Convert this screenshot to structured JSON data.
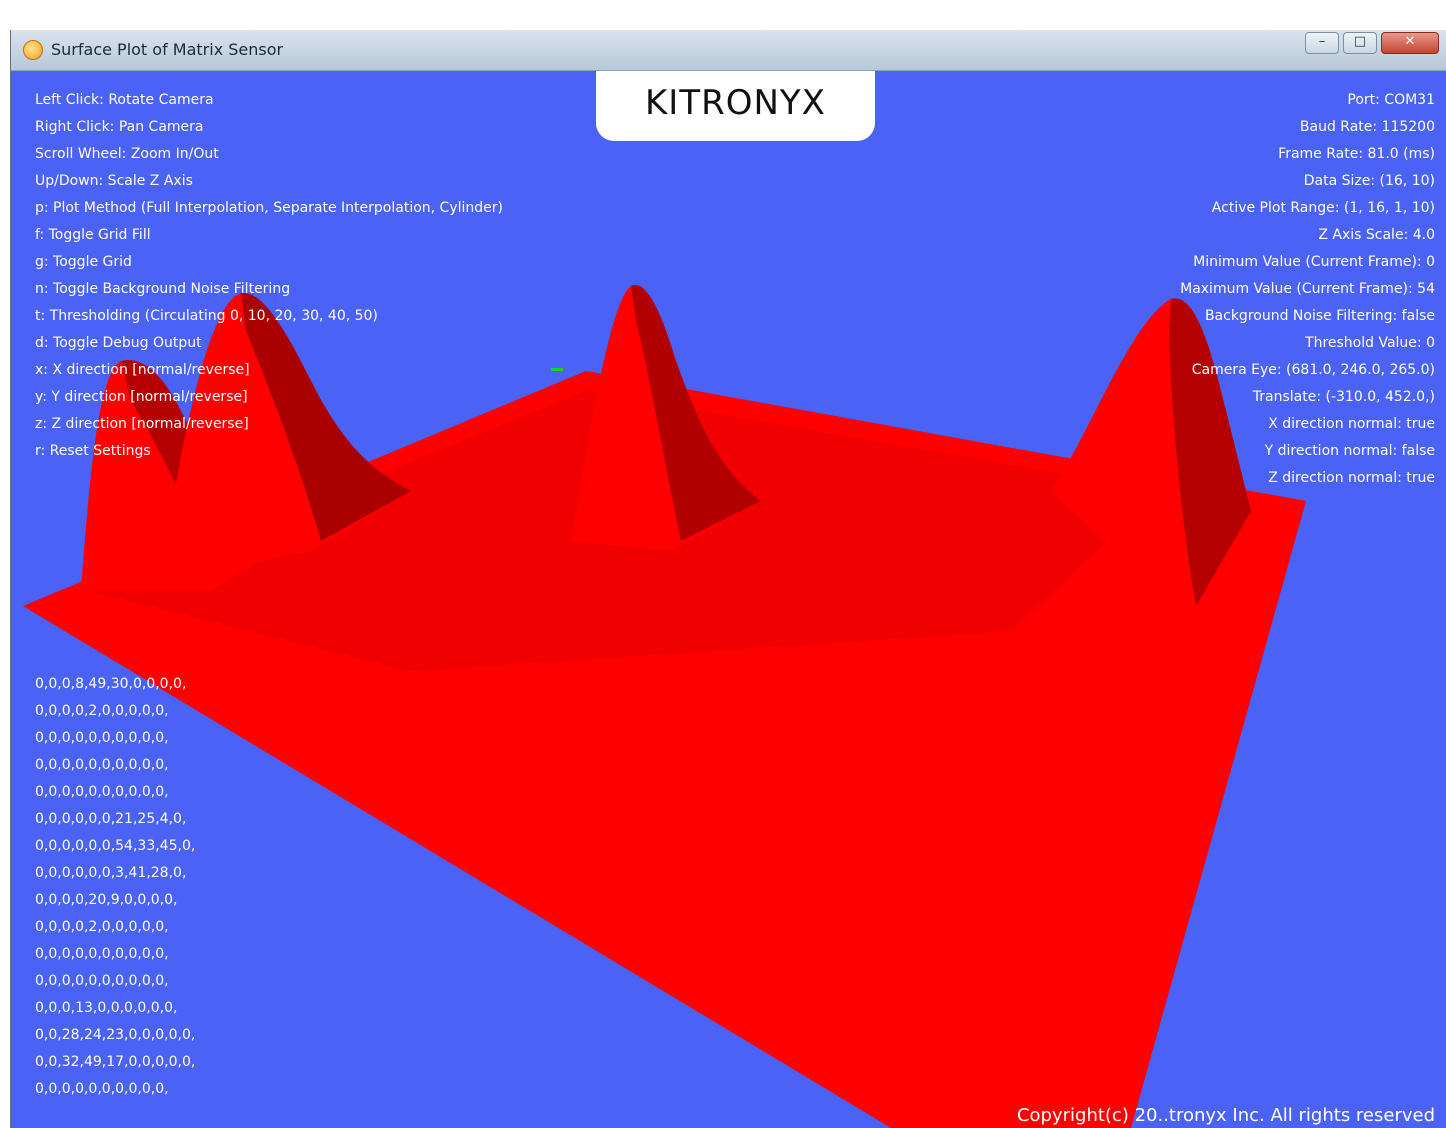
{
  "window": {
    "title": "Surface Plot of Matrix Sensor",
    "minimize_icon": "minimize-icon",
    "maximize_icon": "maximize-icon",
    "close_icon": "close-icon",
    "minimize_glyph": "–",
    "maximize_glyph": "□",
    "close_glyph": "✕"
  },
  "logo": {
    "text": "KITRONYX"
  },
  "colors": {
    "background": "#4a62f6",
    "surface": "#ff0000",
    "surface_shade": "#b80000",
    "text": "#ffffff"
  },
  "help_lines": [
    "Left Click: Rotate Camera",
    "Right Click: Pan Camera",
    "Scroll Wheel: Zoom In/Out",
    "Up/Down: Scale Z Axis",
    "p: Plot Method (Full Interpolation, Separate Interpolation, Cylinder)",
    "f: Toggle Grid Fill",
    "g: Toggle Grid",
    "n: Toggle Background Noise Filtering",
    "t: Thresholding (Circulating 0, 10, 20, 30, 40, 50)",
    "d: Toggle Debug Output",
    "x: X direction [normal/reverse]",
    "y: Y direction [normal/reverse]",
    "z: Z direction [normal/reverse]",
    "r: Reset Settings"
  ],
  "status_lines": [
    "Port: COM31",
    "Baud Rate: 115200",
    "Frame Rate: 81.0 (ms)",
    "Data Size: (16, 10)",
    "Active Plot Range: (1, 16, 1, 10)",
    "Z Axis Scale: 4.0",
    "Minimum Value (Current Frame): 0",
    "Maximum Value (Current Frame): 54",
    "Background Noise Filtering: false",
    "Threshold Value: 0",
    "Camera Eye: (681.0, 246.0, 265.0)",
    "Translate: (-310.0, 452.0,)",
    "X direction normal: true",
    "Y direction normal: false",
    "Z direction normal: true"
  ],
  "matrix_rows": [
    "0,0,0,8,49,30,0,0,0,0,",
    "0,0,0,0,2,0,0,0,0,0,",
    "0,0,0,0,0,0,0,0,0,0,",
    "0,0,0,0,0,0,0,0,0,0,",
    "0,0,0,0,0,0,0,0,0,0,",
    "0,0,0,0,0,0,21,25,4,0,",
    "0,0,0,0,0,0,54,33,45,0,",
    "0,0,0,0,0,0,3,41,28,0,",
    "0,0,0,0,20,9,0,0,0,0,",
    "0,0,0,0,2,0,0,0,0,0,",
    "0,0,0,0,0,0,0,0,0,0,",
    "0,0,0,0,0,0,0,0,0,0,",
    "0,0,0,13,0,0,0,0,0,0,",
    "0,0,28,24,23,0,0,0,0,0,",
    "0,0,32,49,17,0,0,0,0,0,",
    "0,0,0,0,0,0,0,0,0,0,"
  ],
  "copyright": "Copyright(c) 20..tronyx Inc. All rights reserved"
}
